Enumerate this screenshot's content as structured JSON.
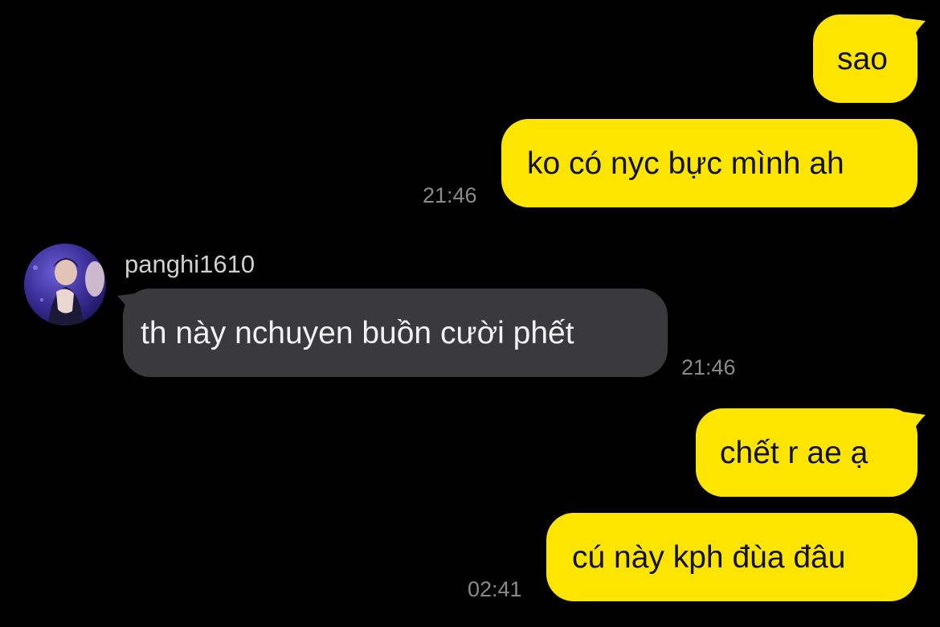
{
  "messages": [
    {
      "direction": "outgoing",
      "text": "sao"
    },
    {
      "direction": "outgoing",
      "text": "ko có nyc bực mình ah",
      "time": "21:46"
    },
    {
      "direction": "incoming",
      "sender": "panghi1610",
      "text": "th này nchuyen buồn cười phết",
      "time": "21:46"
    },
    {
      "direction": "outgoing",
      "text": "chết r ae ạ"
    },
    {
      "direction": "outgoing",
      "text": "cú này kph đùa đâu",
      "time": "02:41"
    }
  ],
  "colors": {
    "background": "#000000",
    "outgoing_bubble": "#fee500",
    "incoming_bubble": "#3a3a3c",
    "timestamp": "#8a8a8a"
  },
  "icons": {
    "avatar": "profile-photo"
  }
}
